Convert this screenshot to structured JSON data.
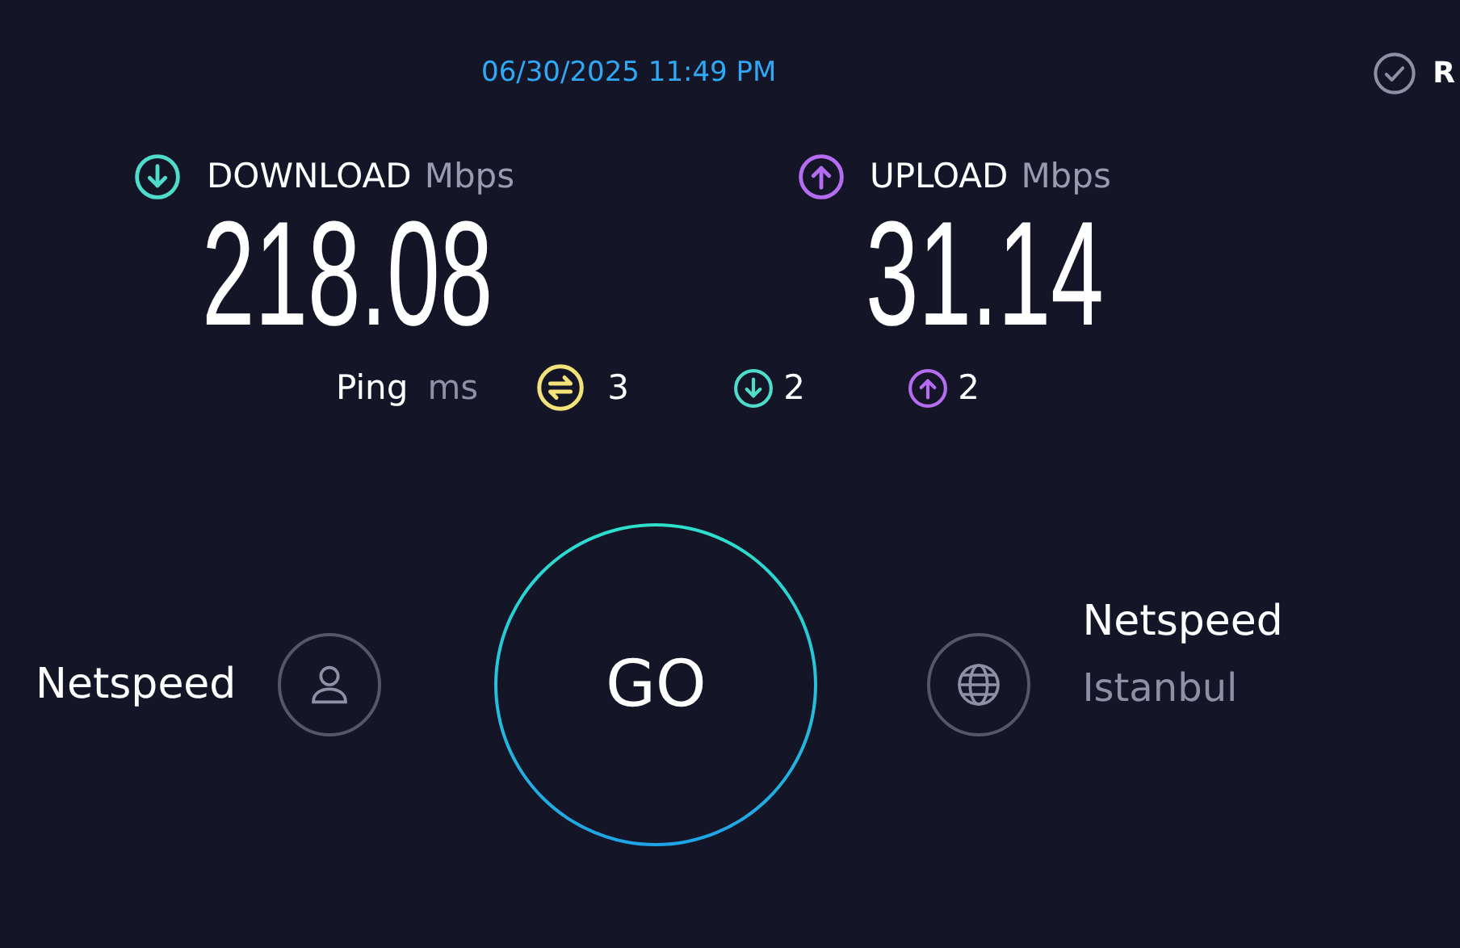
{
  "timestamp": "06/30/2025 11:49 PM",
  "results_link": {
    "label": "R"
  },
  "metrics": [
    {
      "kind": "download",
      "label": "DOWNLOAD",
      "unit": "Mbps",
      "value": "218.08"
    },
    {
      "kind": "upload",
      "label": "UPLOAD",
      "unit": "Mbps",
      "value": "31.14"
    }
  ],
  "ping": {
    "label": "Ping",
    "unit": "ms",
    "readings": [
      {
        "kind": "idle",
        "value": "3"
      },
      {
        "kind": "download",
        "value": "2"
      },
      {
        "kind": "upload",
        "value": "2"
      }
    ]
  },
  "provider": {
    "name": "Netspeed"
  },
  "go_button": {
    "label": "GO"
  },
  "server": {
    "name": "Netspeed",
    "location": "Istanbul"
  }
}
